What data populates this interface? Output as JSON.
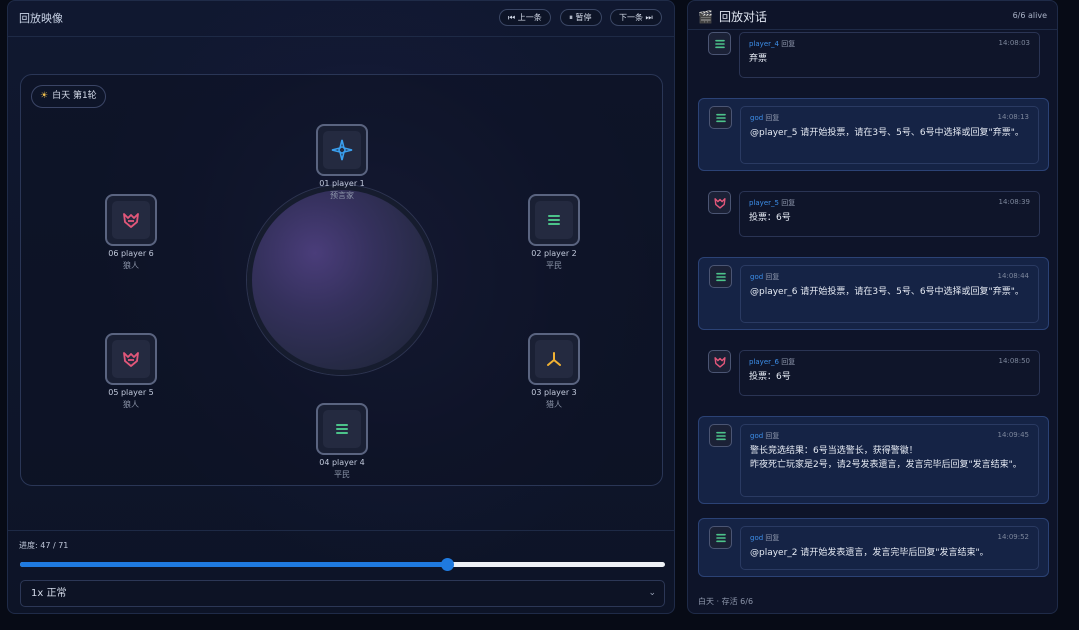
{
  "replay": {
    "title": "回放映像",
    "prev_label": "⏮ 上一条",
    "pause_label": "⏸ 暂停",
    "next_label": "下一条 ⏭",
    "phase_icon": "☀",
    "phase_label": "白天 第1轮",
    "progress_label": "进度: 47 / 71",
    "progress_fraction": 0.662,
    "speed_label": "1x 正常",
    "seats": [
      {
        "name": "01 player 1",
        "role": "预言家",
        "icon": "compass-icon"
      },
      {
        "name": "02 player 2",
        "role": "平民",
        "icon": "menu-icon"
      },
      {
        "name": "03 player 3",
        "role": "猎人",
        "icon": "crossbow-icon"
      },
      {
        "name": "04 player 4",
        "role": "平民",
        "icon": "menu-icon"
      },
      {
        "name": "05 player 5",
        "role": "狼人",
        "icon": "wolf-icon"
      },
      {
        "name": "06 player 6",
        "role": "狼人",
        "icon": "wolf-icon"
      }
    ]
  },
  "dialog": {
    "icon": "🎬",
    "title": "回放对话",
    "alive_count": "6/6 alive",
    "footer": "白天 · 存活 6/6",
    "messages": [
      {
        "speaker": "player_4",
        "verb": "回复",
        "time": "14:08:03",
        "text": "弃票",
        "avatar": "menu-icon",
        "system": false
      },
      {
        "speaker": "god",
        "verb": "回复",
        "time": "14:08:13",
        "text": "@player_5 请开始投票，请在3号、5号、6号中选择或回复\"弃票\"。",
        "avatar": "menu-icon",
        "system": true
      },
      {
        "speaker": "player_5",
        "verb": "回复",
        "time": "14:08:39",
        "text": "投票：6号",
        "avatar": "wolf-icon",
        "system": false
      },
      {
        "speaker": "god",
        "verb": "回复",
        "time": "14:08:44",
        "text": "@player_6 请开始投票，请在3号、5号、6号中选择或回复\"弃票\"。",
        "avatar": "menu-icon",
        "system": true
      },
      {
        "speaker": "player_6",
        "verb": "回复",
        "time": "14:08:50",
        "text": "投票：6号",
        "avatar": "wolf-icon",
        "system": false
      },
      {
        "speaker": "god",
        "verb": "回复",
        "time": "14:09:45",
        "text": "警长竞选结果：6号当选警长，获得警徽！\n昨夜死亡玩家是2号，请2号发表遗言，发言完毕后回复\"发言结束\"。",
        "avatar": "menu-icon",
        "system": true
      },
      {
        "speaker": "god",
        "verb": "回复",
        "time": "14:09:52",
        "text": "@player_2 请开始发表遗言，发言完毕后回复\"发言结束\"。",
        "avatar": "menu-icon",
        "system": true
      }
    ]
  },
  "colors": {
    "accent": "#1f7ae0",
    "speaker": "#3d8ee8",
    "wolf": "#e2577a",
    "villager": "#4cc38a",
    "seer": "#3aa0f0",
    "hunter": "#f2b233"
  }
}
